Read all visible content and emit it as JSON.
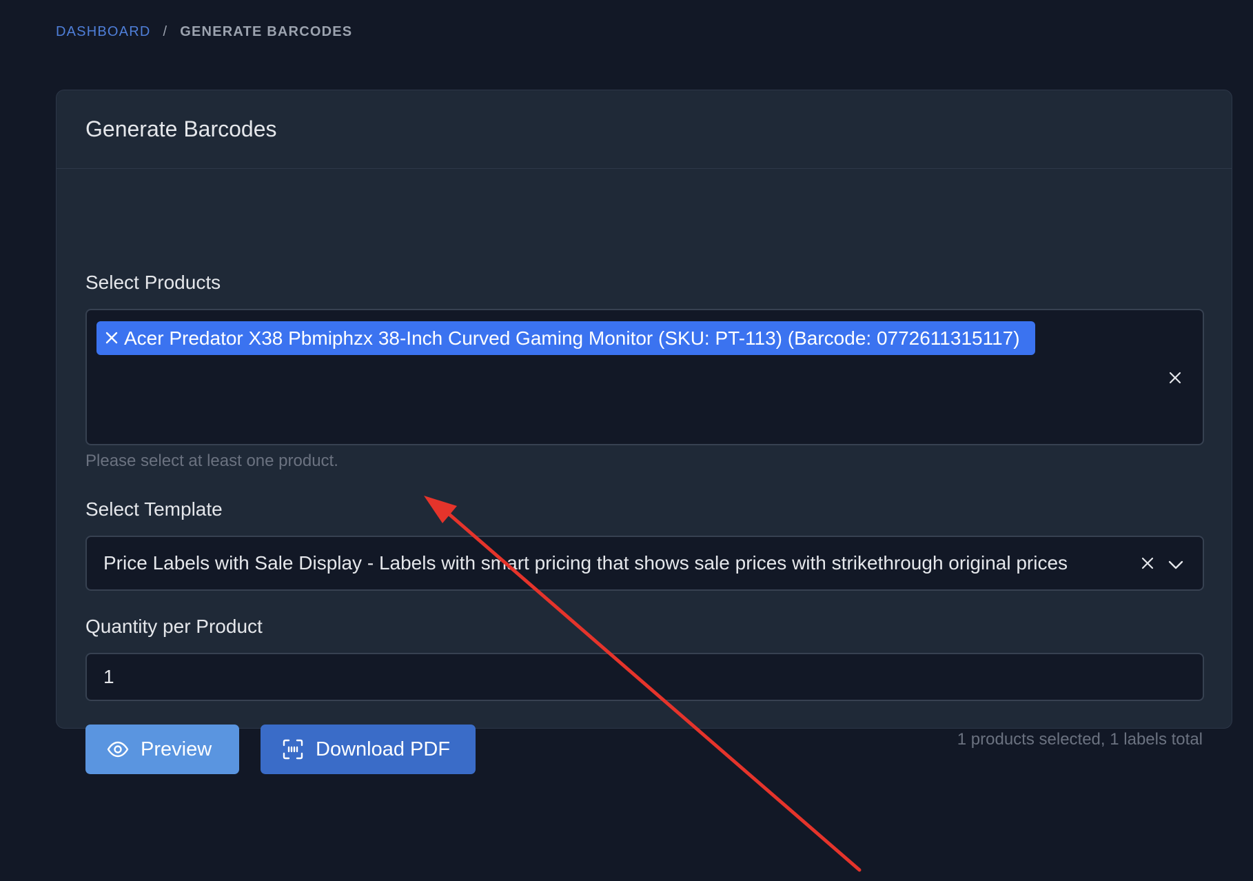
{
  "breadcrumb": {
    "home": "DASHBOARD",
    "separator": "/",
    "current": "GENERATE BARCODES"
  },
  "card": {
    "title": "Generate Barcodes"
  },
  "products": {
    "label": "Select Products",
    "selected": [
      "Acer Predator X38 Pbmiphzx 38-Inch Curved Gaming Monitor (SKU: PT-113) (Barcode: 0772611315117)"
    ],
    "hint": "Please select at least one product."
  },
  "template": {
    "label": "Select Template",
    "value": "Price Labels with Sale Display - Labels with smart pricing that shows sale prices with strikethrough original prices"
  },
  "quantity": {
    "label": "Quantity per Product",
    "value": "1"
  },
  "actions": {
    "preview_label": "Preview",
    "download_label": "Download PDF"
  },
  "summary": "1 products selected, 1 labels total",
  "colors": {
    "background": "#121826",
    "card": "#1f2937",
    "chip": "#3b73f0",
    "preview_button": "#5a95e0",
    "download_button": "#3a6cc8",
    "annotation_arrow": "#e5342b"
  },
  "icons": {
    "chip_remove": "close-icon",
    "clear_all": "close-icon",
    "select_clear": "close-icon",
    "select_open": "chevron-down-icon",
    "preview": "eye-icon",
    "download": "scan-icon"
  }
}
